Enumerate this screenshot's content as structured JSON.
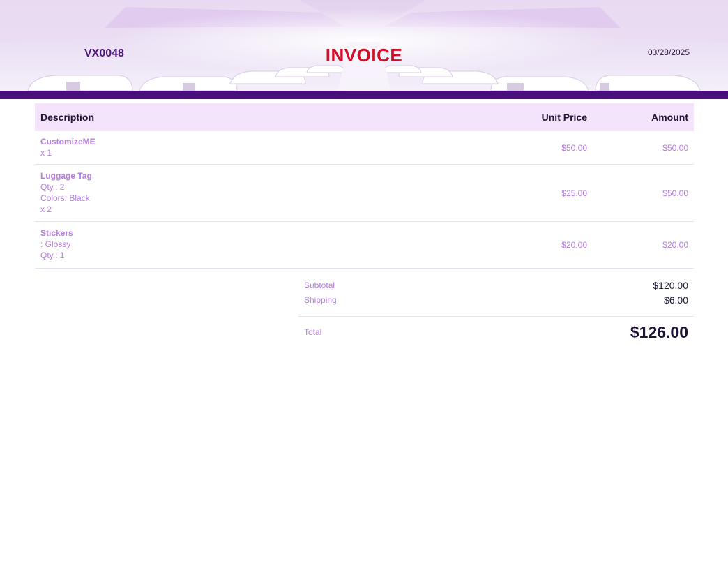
{
  "header": {
    "invoice_number": "VX0048",
    "title": "INVOICE",
    "date": "03/28/2025"
  },
  "table": {
    "columns": {
      "description": "Description",
      "unit_price": "Unit Price",
      "amount": "Amount"
    },
    "rows": [
      {
        "name": "CustomizeME",
        "details": [
          "x 1"
        ],
        "unit_price": "$50.00",
        "amount": "$50.00"
      },
      {
        "name": "Luggage Tag",
        "details": [
          "Qty.: 2",
          "Colors: Black",
          "x 2"
        ],
        "unit_price": "$25.00",
        "amount": "$50.00"
      },
      {
        "name": "Stickers",
        "details": [
          ": Glossy",
          "Qty.: 1"
        ],
        "unit_price": "$20.00",
        "amount": "$20.00"
      }
    ]
  },
  "totals": {
    "subtotal_label": "Subtotal",
    "subtotal_value": "$120.00",
    "shipping_label": "Shipping",
    "shipping_value": "$6.00",
    "total_label": "Total",
    "total_value": "$126.00"
  },
  "colors": {
    "brand_purple": "#4a0e7c",
    "title_red": "#d0102a",
    "accent_lilac": "#b67ddd",
    "header_row_bg": "#f3e3fb"
  }
}
